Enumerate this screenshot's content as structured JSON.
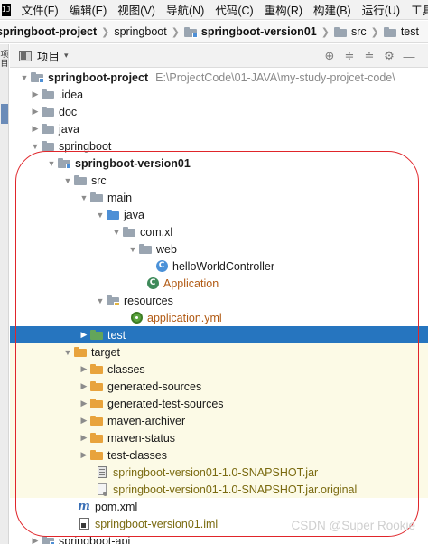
{
  "menu": {
    "app_icon_text": "IJ",
    "items": [
      "文件(F)",
      "编辑(E)",
      "视图(V)",
      "导航(N)",
      "代码(C)",
      "重构(R)",
      "构建(B)",
      "运行(U)",
      "工具(T)"
    ]
  },
  "breadcrumb": {
    "items": [
      "springboot-project",
      "springboot",
      "springboot-version01",
      "src",
      "test"
    ]
  },
  "sidestrip": {
    "label": "项目"
  },
  "tool_header": {
    "title": "项目",
    "dropdown": "▾",
    "actions": [
      "⊕",
      "≑",
      "≐",
      "⚙",
      "—"
    ]
  },
  "tree": {
    "rows": [
      {
        "label": "springboot-project",
        "path": "E:\\ProjectCode\\01-JAVA\\my-study-projcet-code\\"
      },
      {
        "label": ".idea"
      },
      {
        "label": "doc"
      },
      {
        "label": "java"
      },
      {
        "label": "springboot"
      },
      {
        "label": "springboot-version01"
      },
      {
        "label": "src"
      },
      {
        "label": "main"
      },
      {
        "label": "java"
      },
      {
        "label": "com.xl"
      },
      {
        "label": "web"
      },
      {
        "label": "helloWorldController"
      },
      {
        "label": "Application"
      },
      {
        "label": "resources"
      },
      {
        "label": "application.yml"
      },
      {
        "label": "test"
      },
      {
        "label": "target"
      },
      {
        "label": "classes"
      },
      {
        "label": "generated-sources"
      },
      {
        "label": "generated-test-sources"
      },
      {
        "label": "maven-archiver"
      },
      {
        "label": "maven-status"
      },
      {
        "label": "test-classes"
      },
      {
        "label": "springboot-version01-1.0-SNAPSHOT.jar"
      },
      {
        "label": "springboot-version01-1.0-SNAPSHOT.jar.original"
      },
      {
        "label": "pom.xml"
      },
      {
        "label": "springboot-version01.iml"
      },
      {
        "label": "springboot-api"
      }
    ]
  },
  "watermark": "CSDN @Super Rookie",
  "colors": {
    "selection": "#2675bf",
    "excluded_bg": "#fcfae6",
    "annotation": "#e0252a"
  }
}
